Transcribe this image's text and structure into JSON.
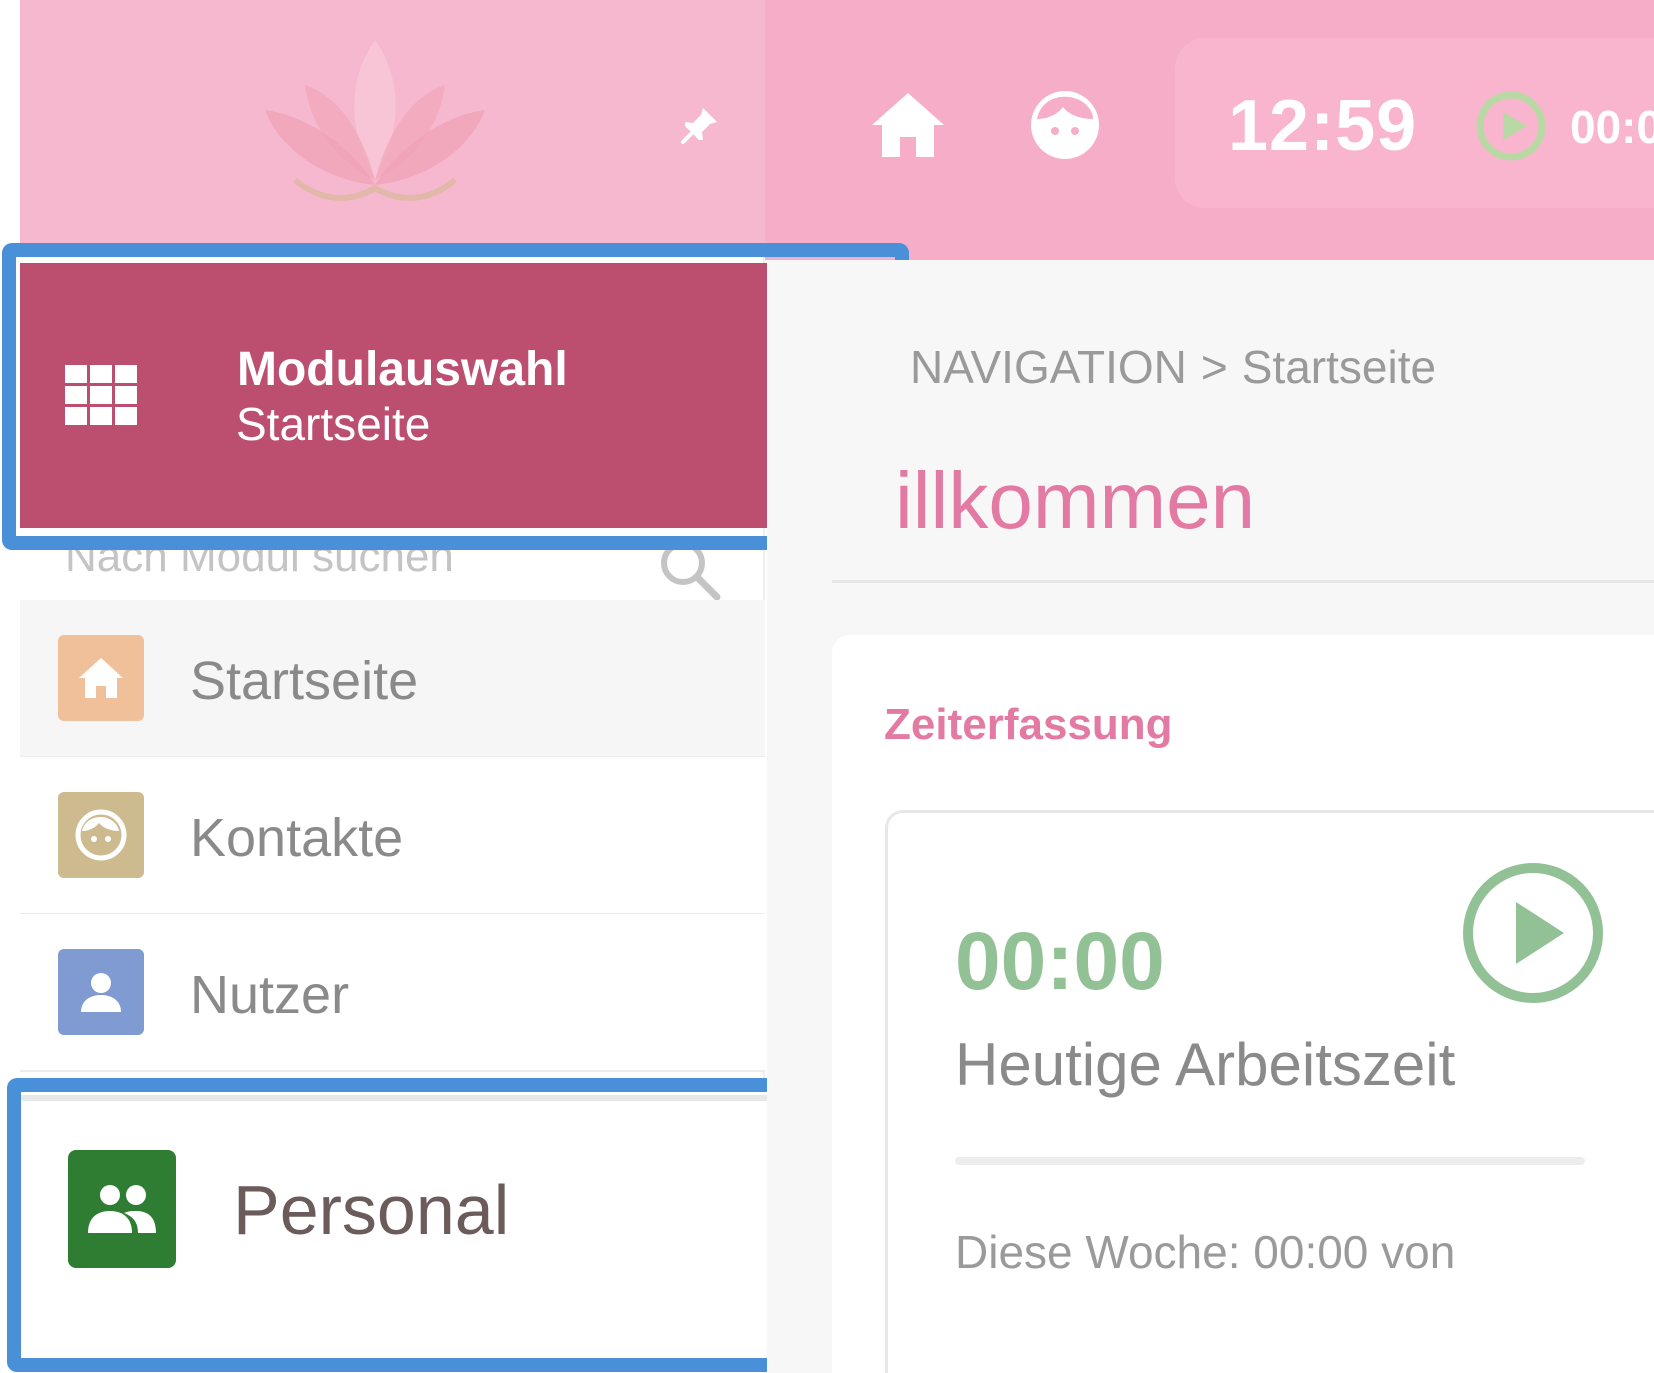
{
  "header": {
    "clock_time": "12:59",
    "timer_display": "00:0"
  },
  "module_selector": {
    "title": "Modulauswahl",
    "subtitle": "Startseite"
  },
  "search": {
    "placeholder": "Nach Modul suchen"
  },
  "sidebar": {
    "items": [
      {
        "label": "Startseite",
        "icon": "home-icon",
        "color": "#f0c09a",
        "active": true
      },
      {
        "label": "Kontakte",
        "icon": "contact-face-icon",
        "color": "#cdbb8f",
        "active": false
      },
      {
        "label": "Nutzer",
        "icon": "user-icon",
        "color": "#7f9bd1",
        "active": false
      },
      {
        "label": "Personal",
        "icon": "group-icon",
        "color": "#2e7d32",
        "active": false
      }
    ]
  },
  "main": {
    "breadcrumb": {
      "root": "NAVIGATION",
      "separator": ">",
      "current": "Startseite"
    },
    "page_title": "illkommen",
    "card": {
      "title": "Zeiterfassung",
      "time_value": "00:00",
      "time_label": "Heutige Arbeitszeit",
      "week_text": "Diese Woche: 00:00 von"
    }
  },
  "colors": {
    "header_pink": "#f6adc7",
    "module_selector": "#bc4f70",
    "highlight_outline": "#4a90d9",
    "accent_pink": "#e37aa3",
    "timer_green": "#93c196"
  }
}
